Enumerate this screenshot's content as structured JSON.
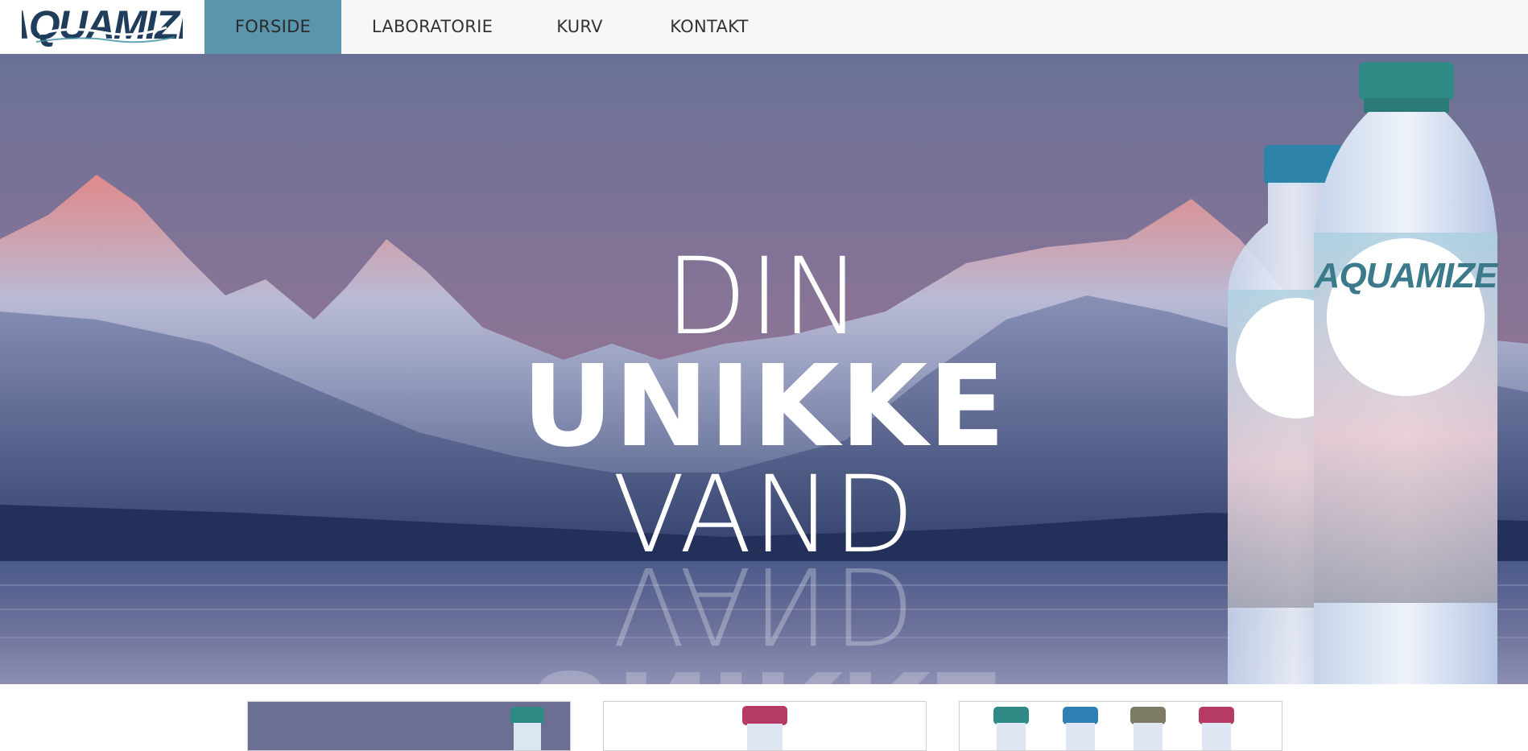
{
  "brand": {
    "logo_text": "AQUAMIZE",
    "accent": "#5a95ad",
    "logo_dark": "#1f3d5a",
    "logo_teal": "#3f8fa3"
  },
  "nav": {
    "items": [
      {
        "label": "FORSIDE",
        "active": true
      },
      {
        "label": "LABORATORIE",
        "active": false
      },
      {
        "label": "KURV",
        "active": false
      },
      {
        "label": "KONTAKT",
        "active": false
      }
    ]
  },
  "hero": {
    "line1": "DIN",
    "line2": "UNIKKE",
    "line3": "VAND",
    "bottle_label": "AQUAMIZE"
  },
  "cards": [
    {
      "name": "card-1",
      "caps": [
        "#2f8a86"
      ]
    },
    {
      "name": "card-2",
      "caps": [
        "#b53a66"
      ]
    },
    {
      "name": "card-3",
      "caps": [
        "#2f8a86",
        "#2f7fb5",
        "#7d7b63",
        "#b53a66"
      ]
    }
  ]
}
